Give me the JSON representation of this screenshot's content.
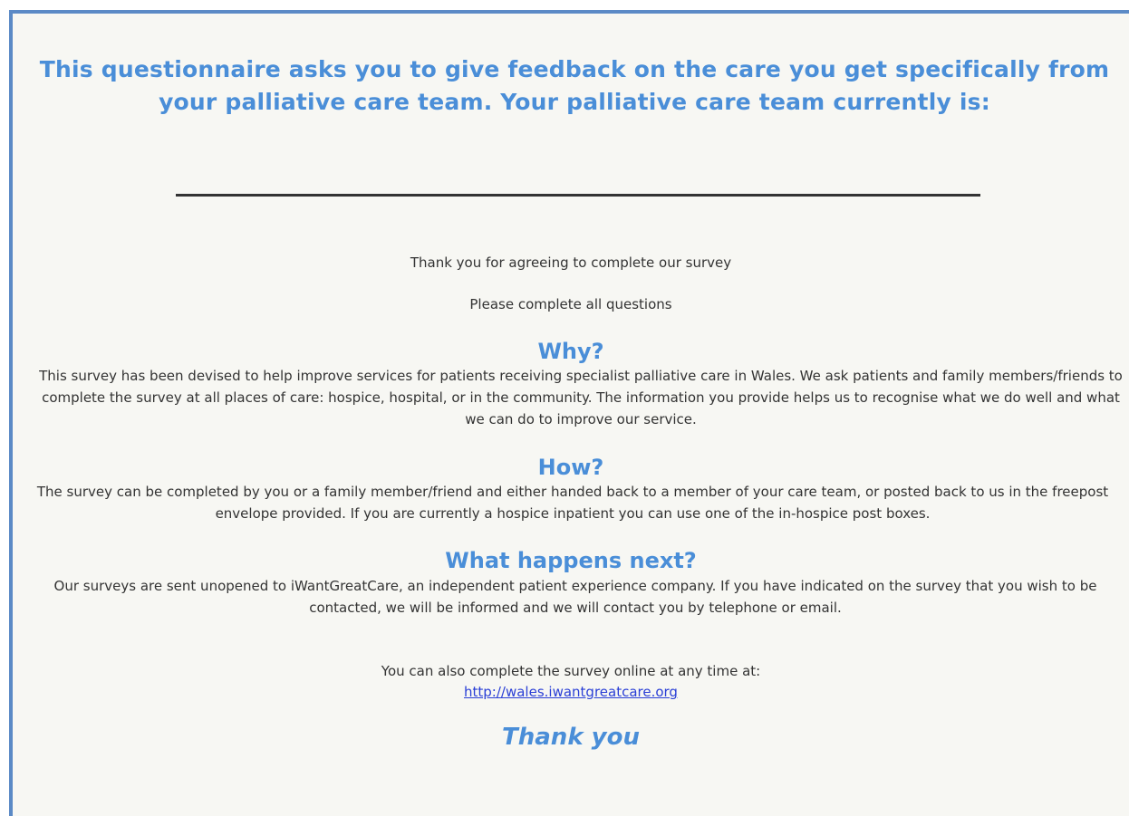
{
  "intro": {
    "heading": "This questionnaire asks you to give feedback on the care you get specifically from your palliative care team.  Your palliative care team currently is:",
    "thank_you_line": "Thank you for agreeing to complete our survey",
    "instruction": "Please complete all questions"
  },
  "why": {
    "title": "Why?",
    "body": "This survey has been devised to help improve services for patients receiving specialist palliative care in Wales. We ask patients and family members/friends to complete the survey at all places of care: hospice, hospital, or in the community. The information you provide helps us to recognise what we do well and what we can do to improve our service."
  },
  "how": {
    "title": "How?",
    "body": "The survey can be completed by you or a family member/friend and either handed back to a member of your care team, or posted back to us in the freepost envelope provided. If you are currently a hospice inpatient you can use one of the in-hospice post boxes."
  },
  "next": {
    "title": "What happens next?",
    "body": "Our surveys are sent unopened to iWantGreatCare, an independent patient experience company. If you have indicated on the survey that you wish to be contacted, we will be informed and we will contact you by telephone or email."
  },
  "online": {
    "text": "You can also complete the survey online at any time at:",
    "link_text": "http://wales.iwantgreatcare.org"
  },
  "closing": {
    "text": "Thank you"
  },
  "colors": {
    "accent": "#4a8ed8",
    "border": "#5b8ac6",
    "link": "#2a3fd6",
    "background": "#f7f7f3"
  }
}
